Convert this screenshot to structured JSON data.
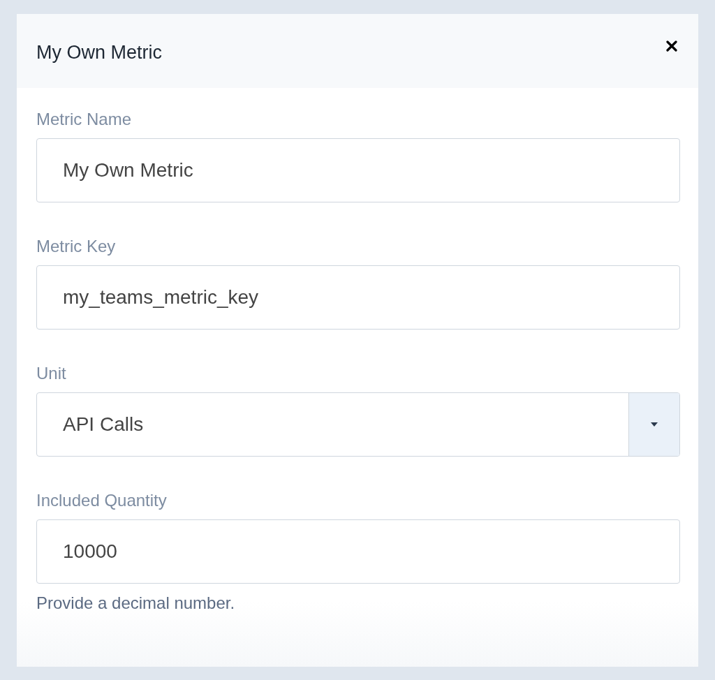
{
  "dialog": {
    "title": "My Own Metric"
  },
  "fields": [
    {
      "kind": "text",
      "label": "Metric Name",
      "value": "My Own Metric"
    },
    {
      "kind": "text",
      "label": "Metric Key",
      "value": "my_teams_metric_key"
    },
    {
      "kind": "select",
      "label": "Unit",
      "value": "API Calls"
    },
    {
      "kind": "text",
      "label": "Included Quantity",
      "value": "10000",
      "help": "Provide a decimal number."
    }
  ]
}
